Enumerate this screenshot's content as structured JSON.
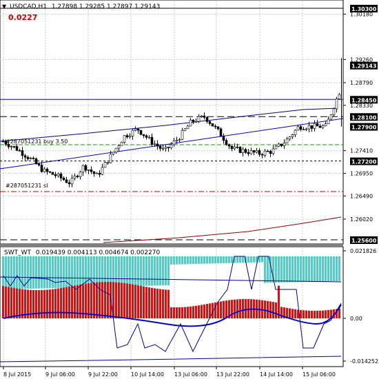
{
  "main_chart": {
    "title": "USDCAD,H1",
    "ohlc": "1.27898 1.29285 1.27897 1.29143",
    "profit": "0.0227",
    "price_labels": [
      "1.30300",
      "1.29143",
      "1.28450",
      "1.28100",
      "1.27900",
      "1.27200",
      "1.25600"
    ],
    "price_ticks": [
      "1.30180",
      "1.29260",
      "1.28790",
      "1.28330",
      "1.27410",
      "1.26950",
      "1.26490",
      "1.26020"
    ],
    "order_buy_label": "#287051231 buy 3.50",
    "order_sl_label": "#287051231 sl"
  },
  "indicator": {
    "name": "SWT_WT",
    "values": "0.019439 0.004113 0.004674 0.002270",
    "ticks": [
      "0.021826",
      "0.00",
      "-0.014252"
    ]
  },
  "time_axis": {
    "labels": [
      "8 Jul 2015",
      "9 Jul 06:00",
      "9 Jul 22:00",
      "10 Jul 14:00",
      "13 Jul 06:00",
      "13 Jul 22:00",
      "14 Jul 14:00",
      "15 Jul 06:00"
    ]
  },
  "colors": {
    "background": "#ffffff",
    "grid": "#c8c8c8",
    "candle": "#000000",
    "trendline": "#0000cc",
    "ma_line": "#00008b",
    "dashed_level": "#000000",
    "stoploss_line": "#cc0000",
    "buy_line": "#00a000",
    "lower_channel": "#8b0000",
    "histogram_top": "#48d1cc",
    "histogram_bottom": "#ff0000",
    "profit_text": "#cc0000",
    "price_tag_bg": "#000000",
    "price_tag_text": "#ffffff"
  }
}
